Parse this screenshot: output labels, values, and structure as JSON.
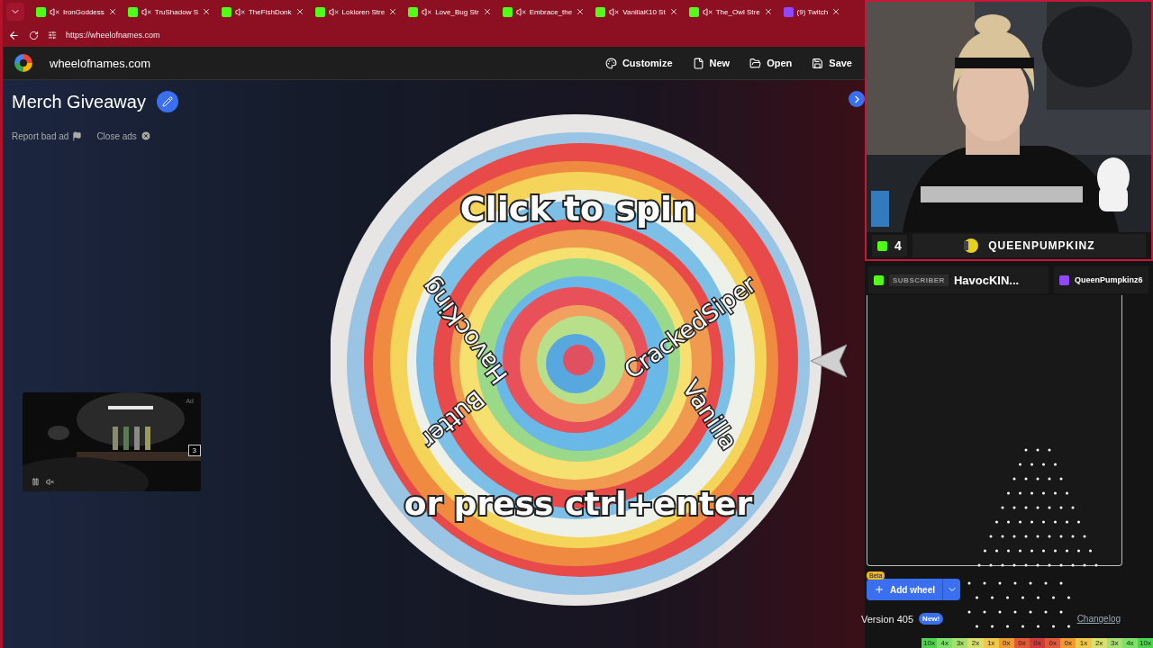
{
  "browser": {
    "tabs": [
      {
        "kind": "kick",
        "title": "IronGoddess",
        "muted": true
      },
      {
        "kind": "kick",
        "title": "TruShadow S",
        "muted": true
      },
      {
        "kind": "kick",
        "title": "TheFishDonk",
        "muted": true
      },
      {
        "kind": "kick",
        "title": "Lokloren Stre",
        "muted": true
      },
      {
        "kind": "kick",
        "title": "Love_Bug Str",
        "muted": true
      },
      {
        "kind": "kick",
        "title": "Embrace_the",
        "muted": true
      },
      {
        "kind": "kick",
        "title": "VanillaK10 St",
        "muted": true
      },
      {
        "kind": "kick",
        "title": "The_Owl Stre",
        "muted": true
      },
      {
        "kind": "twitch",
        "title": "(9) Twitch",
        "muted": false
      }
    ],
    "url": "https://wheelofnames.com"
  },
  "site": {
    "brand": "wheelofnames.com",
    "actions": [
      {
        "kind": "customize",
        "label": "Customize"
      },
      {
        "kind": "new",
        "label": "New"
      },
      {
        "kind": "open",
        "label": "Open"
      },
      {
        "kind": "save",
        "label": "Save"
      }
    ],
    "title": "Merch Giveaway",
    "ad_links": [
      {
        "kind": "report",
        "label": "Report bad ad"
      },
      {
        "kind": "close",
        "label": "Close ads"
      }
    ],
    "ad": {
      "label": "Ad",
      "skip_count": "3"
    },
    "wheel": {
      "prompt": "Click to spin",
      "hint": "or press ctrl+enter",
      "entries": [
        "HavocKing",
        "CrackedSiper",
        "Butter",
        "Vanilla"
      ]
    },
    "add_wheel": {
      "badge": "Beta",
      "label": "Add wheel"
    },
    "version": "Version 405",
    "new_badge": "New!",
    "changelog": "Changelog"
  },
  "overlay": {
    "count": "4",
    "streamer": "QUEENPUMPKINZ",
    "chat": [
      {
        "kind": "kick",
        "badge": "SUBSCRIBER",
        "name": "HavocKIN..."
      },
      {
        "kind": "twitch",
        "name": "QueenPumpkinz6"
      }
    ],
    "plinko_multipliers": [
      {
        "label": "10x",
        "color": "#4cd44c"
      },
      {
        "label": "4x",
        "color": "#7ee06a"
      },
      {
        "label": "3x",
        "color": "#a8e070"
      },
      {
        "label": "2x",
        "color": "#d8e070"
      },
      {
        "label": "1x",
        "color": "#f0c848"
      },
      {
        "label": "0x",
        "color": "#f09a30"
      },
      {
        "label": "0x",
        "color": "#e05a3a"
      },
      {
        "label": "0x",
        "color": "#d03a3a"
      },
      {
        "label": "0x",
        "color": "#e05a3a"
      },
      {
        "label": "0x",
        "color": "#f09a30"
      },
      {
        "label": "1x",
        "color": "#f0c848"
      },
      {
        "label": "2x",
        "color": "#d8e070"
      },
      {
        "label": "3x",
        "color": "#a8e070"
      },
      {
        "label": "4x",
        "color": "#7ee06a"
      },
      {
        "label": "10x",
        "color": "#4cd44c"
      }
    ]
  }
}
